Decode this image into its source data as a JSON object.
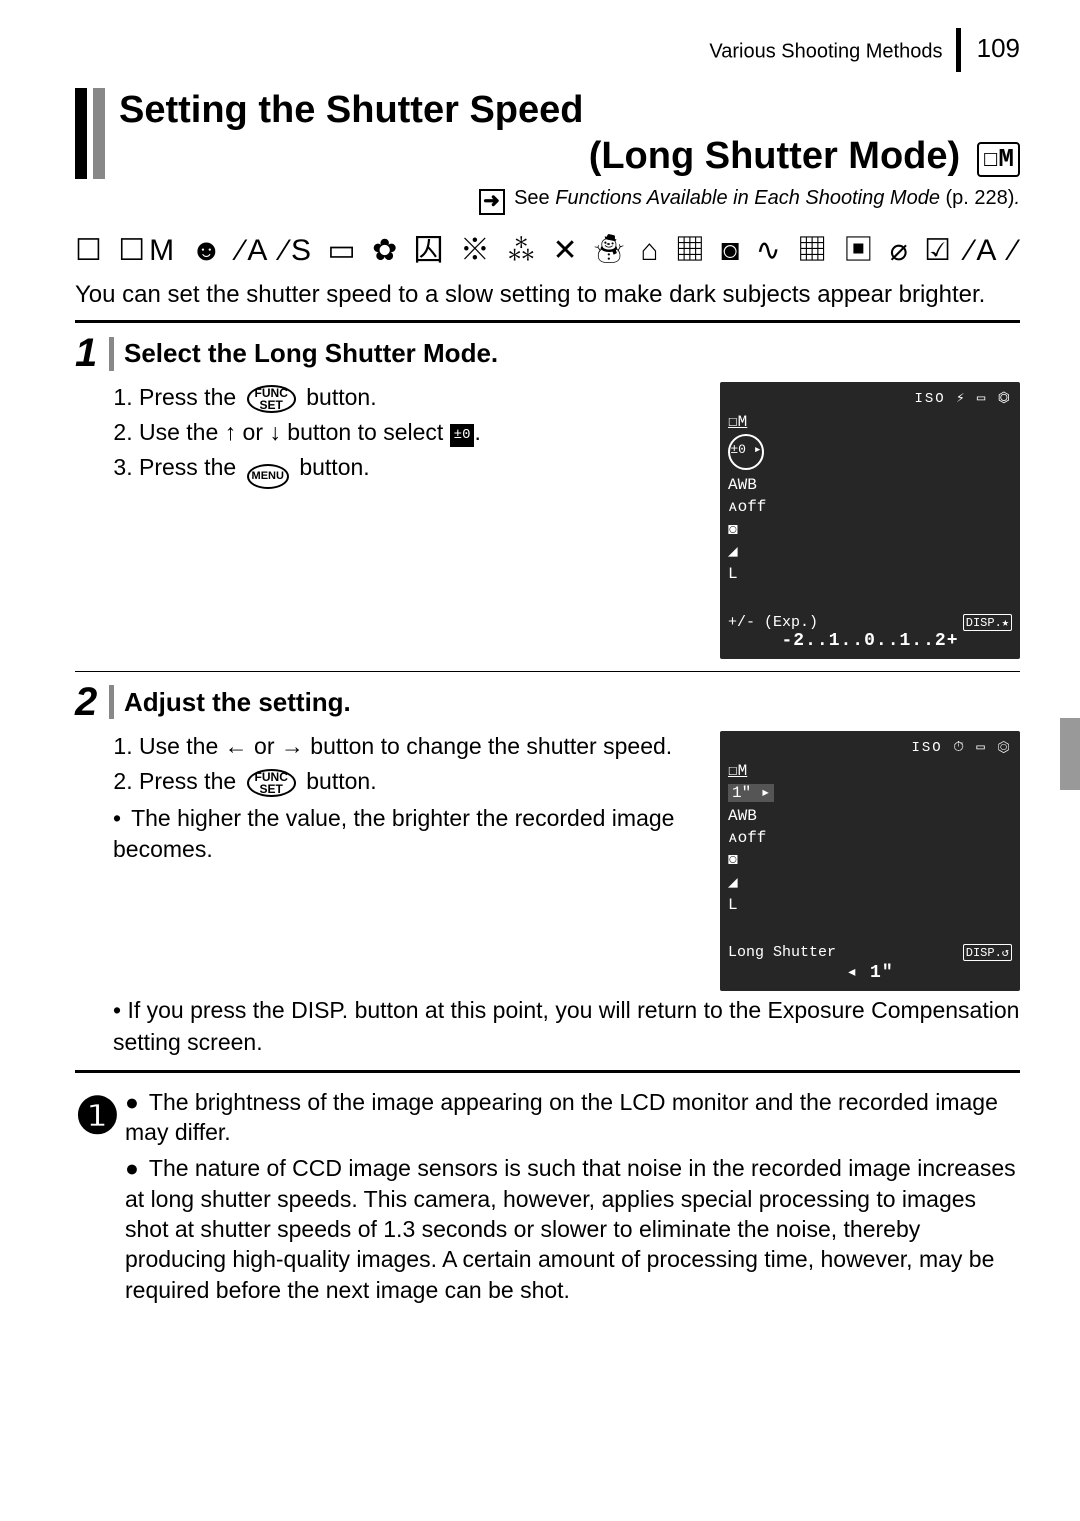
{
  "header": {
    "section": "Various Shooting Methods",
    "page_number": "109"
  },
  "title": {
    "line1": "Setting the Shutter Speed",
    "line2": "(Long Shutter Mode)",
    "mode_icon": "☐M"
  },
  "reference": {
    "prefix": "See",
    "text": "Functions Available in Each Shooting Mode",
    "page": "(p. 228)"
  },
  "iconstrip": "☐ ☐M ☻ ⁄A ⁄S ▭ ✿ 囚 ※ ⁂ ✕ ☃ ⌂ ▦ ◙ ∿ ▦ ▣ ⌀ ☑ ⁄A ⁄S ❄",
  "intro": "You can set the shutter speed to a slow setting to make dark subjects appear brighter.",
  "steps": [
    {
      "num": "1",
      "title": "Select the Long Shutter Mode.",
      "items": [
        {
          "pre": "Press the ",
          "btn": "FUNC/SET",
          "post": " button."
        },
        {
          "pre": "Use the ",
          "mid1": "↑",
          "conj": " or ",
          "mid2": "↓",
          "post": " button to select ",
          "box": "±0",
          "tail": "."
        },
        {
          "pre": "Press the ",
          "btn": "MENU",
          "post": " button."
        }
      ],
      "lcd": {
        "toprow": "ISO ⚡ ▭ ⏣",
        "mode": "☐M",
        "circled": "±0 ▸",
        "side": [
          "AWB",
          "ᴀoff",
          "◙",
          "◢",
          "L"
        ],
        "footer_left": "+/- (Exp.)",
        "footer_right": "DISP.★",
        "scale": "-2..1..0..1..2+"
      }
    },
    {
      "num": "2",
      "title": "Adjust the setting.",
      "items": [
        {
          "pre": "Use the ",
          "mid1": "←",
          "conj": " or ",
          "mid2": "→",
          "post": " button to change the shutter speed."
        },
        {
          "pre": "Press the ",
          "btn": "FUNC/SET",
          "post": " button."
        }
      ],
      "bullets": [
        "The higher the value, the brighter the recorded image becomes.",
        "If you press the DISP. button at this point, you will return to the Exposure Compensation setting screen."
      ],
      "lcd": {
        "toprow": "ISO ⏱ ▭ ⏣",
        "mode": "☐M",
        "line1": "1\" ▸",
        "side": [
          "AWB",
          "ᴀoff",
          "◙",
          "◢",
          "L"
        ],
        "footer_left": "Long Shutter",
        "footer_right": "DISP.↺",
        "scale": "◂ 1\""
      }
    }
  ],
  "notes": [
    "The brightness of the image appearing on the LCD monitor and the recorded image may differ.",
    "The nature of CCD image sensors is such that noise in the recorded image increases at long shutter speeds. This camera, however, applies special processing to images shot at shutter speeds of 1.3 seconds or slower to eliminate the noise, thereby producing high-quality images. A certain amount of processing time, however, may be required before the next image can be shot."
  ]
}
